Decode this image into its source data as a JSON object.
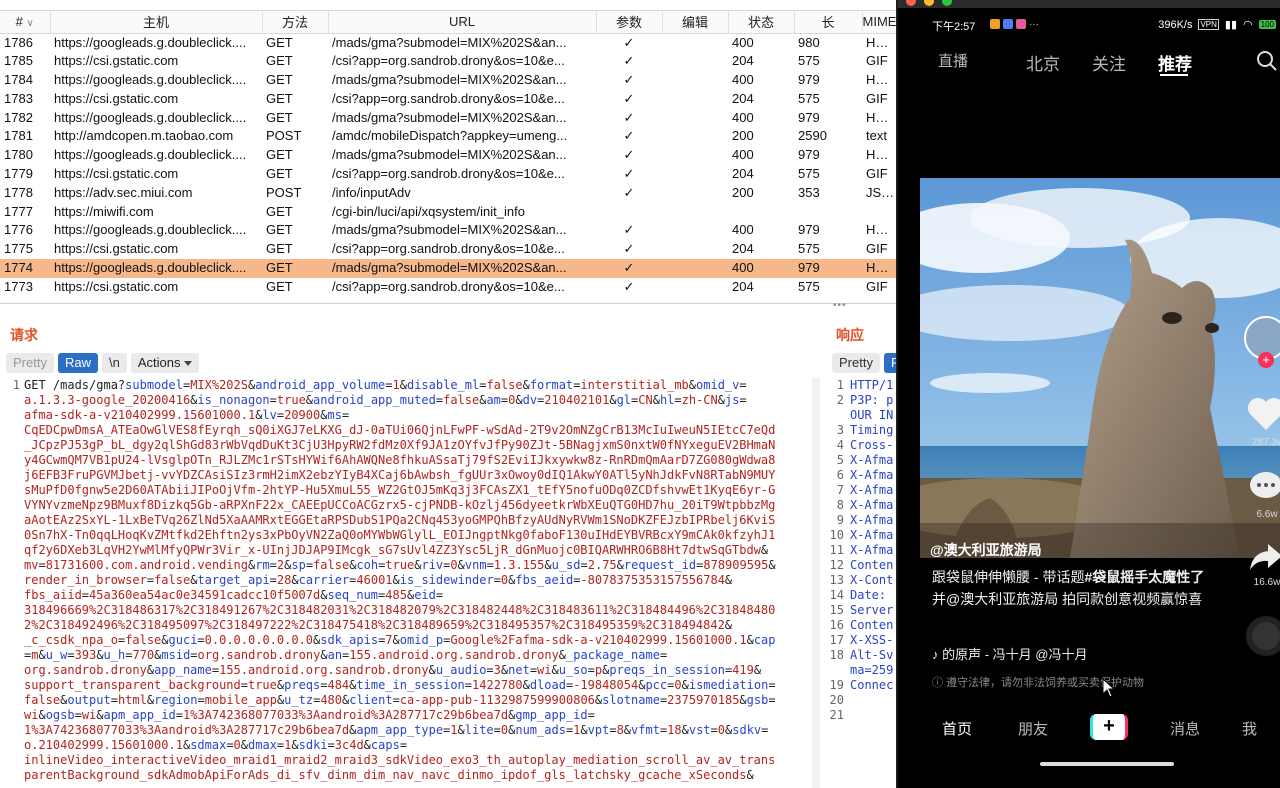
{
  "table": {
    "headers": [
      "#",
      "主机",
      "方法",
      "URL",
      "参数",
      "编辑",
      "状态",
      "长",
      "MIME"
    ],
    "sort_indicator": "∨",
    "rows": [
      {
        "id": "1786",
        "host": "https://googleads.g.doubleclick....",
        "method": "GET",
        "url": "/mads/gma?submodel=MIX%202S&an...",
        "params": "✓",
        "edit": "",
        "status": "400",
        "length": "980",
        "mime": "HTML"
      },
      {
        "id": "1785",
        "host": "https://csi.gstatic.com",
        "method": "GET",
        "url": "/csi?app=org.sandrob.drony&os=10&e...",
        "params": "✓",
        "edit": "",
        "status": "204",
        "length": "575",
        "mime": "GIF"
      },
      {
        "id": "1784",
        "host": "https://googleads.g.doubleclick....",
        "method": "GET",
        "url": "/mads/gma?submodel=MIX%202S&an...",
        "params": "✓",
        "edit": "",
        "status": "400",
        "length": "979",
        "mime": "HTML"
      },
      {
        "id": "1783",
        "host": "https://csi.gstatic.com",
        "method": "GET",
        "url": "/csi?app=org.sandrob.drony&os=10&e...",
        "params": "✓",
        "edit": "",
        "status": "204",
        "length": "575",
        "mime": "GIF"
      },
      {
        "id": "1782",
        "host": "https://googleads.g.doubleclick....",
        "method": "GET",
        "url": "/mads/gma?submodel=MIX%202S&an...",
        "params": "✓",
        "edit": "",
        "status": "400",
        "length": "979",
        "mime": "HTML"
      },
      {
        "id": "1781",
        "host": "http://amdcopen.m.taobao.com",
        "method": "POST",
        "url": "/amdc/mobileDispatch?appkey=umeng...",
        "params": "✓",
        "edit": "",
        "status": "200",
        "length": "2590",
        "mime": "text"
      },
      {
        "id": "1780",
        "host": "https://googleads.g.doubleclick....",
        "method": "GET",
        "url": "/mads/gma?submodel=MIX%202S&an...",
        "params": "✓",
        "edit": "",
        "status": "400",
        "length": "979",
        "mime": "HTML"
      },
      {
        "id": "1779",
        "host": "https://csi.gstatic.com",
        "method": "GET",
        "url": "/csi?app=org.sandrob.drony&os=10&e...",
        "params": "✓",
        "edit": "",
        "status": "204",
        "length": "575",
        "mime": "GIF"
      },
      {
        "id": "1778",
        "host": "https://adv.sec.miui.com",
        "method": "POST",
        "url": "/info/inputAdv",
        "params": "✓",
        "edit": "",
        "status": "200",
        "length": "353",
        "mime": "JSON"
      },
      {
        "id": "1777",
        "host": "https://miwifi.com",
        "method": "GET",
        "url": "/cgi-bin/luci/api/xqsystem/init_info",
        "params": "",
        "edit": "",
        "status": "",
        "length": "",
        "mime": ""
      },
      {
        "id": "1776",
        "host": "https://googleads.g.doubleclick....",
        "method": "GET",
        "url": "/mads/gma?submodel=MIX%202S&an...",
        "params": "✓",
        "edit": "",
        "status": "400",
        "length": "979",
        "mime": "HTML"
      },
      {
        "id": "1775",
        "host": "https://csi.gstatic.com",
        "method": "GET",
        "url": "/csi?app=org.sandrob.drony&os=10&e...",
        "params": "✓",
        "edit": "",
        "status": "204",
        "length": "575",
        "mime": "GIF"
      },
      {
        "id": "1774",
        "host": "https://googleads.g.doubleclick....",
        "method": "GET",
        "url": "/mads/gma?submodel=MIX%202S&an...",
        "params": "✓",
        "edit": "",
        "status": "400",
        "length": "979",
        "mime": "HTML",
        "selected": true
      },
      {
        "id": "1773",
        "host": "https://csi.gstatic.com",
        "method": "GET",
        "url": "/csi?app=org.sandrob.drony&os=10&e...",
        "params": "✓",
        "edit": "",
        "status": "204",
        "length": "575",
        "mime": "GIF"
      }
    ]
  },
  "request_pane": {
    "title": "请求",
    "tabs": {
      "pretty": "Pretty",
      "raw": "Raw",
      "newline": "\\n",
      "actions": "Actions"
    },
    "line_numbers": [
      "1",
      "",
      "",
      "",
      "",
      "",
      "",
      "",
      "",
      "",
      "",
      "",
      "",
      "",
      "",
      "",
      "",
      "",
      "",
      "",
      "",
      "",
      "",
      "",
      "",
      "",
      ""
    ],
    "lines": [
      "GET /mads/gma?submodel=MIX%202S&android_app_volume=1&disable_ml=false&format=interstitial_mb&omid_v=",
      "a.1.3.3-google_20200416&is_nonagon=true&android_app_muted=false&am=0&dv=210402101&gl=CN&hl=zh-CN&js=",
      "afma-sdk-a-v210402999.15601000.1&lv=20900&ms=",
      "CqEDCpwDmsA_ATEaOwGlVES8fEyrqh_sQ0iXGJ7eLKXG_dJ-0aTUi06QjnLFwPF-wSdAd-2T9v2OmNZgCrB13McIuIweuN5IEtcC7eQd",
      "_JCpzPJ53gP_bL_dgy2qlShGd83rWbVqdDuKt3CjU3HpyRW2fdMz0Xf9JA1zOYfvJfPy90ZJt-5BNagjxmS0nxtW0fNYxeguEV2BHmaN",
      "y4GCwmQM7VB1pU24-lVsglpOTn_RJLZMc1rSTsHYWif6AhAWQNe8fhkuASsaTj79fS2EviIJkxywkw8z-RnRDmQmAarD7ZG080gWdwa8",
      "j6EFB3FruPGVMJbetj-vvYDZCAsiSIz3rmH2imX2ebzYIyB4XCaj6bAwbsh_fgUUr3xOwoy0dIQ1AkwY0ATl5yNhJdkFvN8RTabN9MUY",
      "sMuPfD0fgnw5e2D60ATAbiiJIPoOjVfm-2htYP-Hu5XmuL55_WZ2GtOJ5mKq3j3FCAsZX1_tEfY5nofuODq0ZCDfshvwEt1KyqE6yr-G",
      "VYNYvzmeNpz9BMuxf8Dizkq5Gb-aRPXnF22x_CAEEpUCCoACGzrx5-cjPNDB-kOzlj456dyeetkrWbXEuQTG0HD7hu_20iT9WtpbbzMg",
      "aAotEAz2SxYL-1LxBeTVq26ZlNd5XaAAMRxtEGGEtaRPSDubS1PQa2CNq453yoGMPQhBfzyAUdNyRVWm1SNoDKZFEJzbIPRbelj6KviS",
      "0Sn7hX-Tn0qqLHoqKvZMtfkd2Ehftn2ys3xPbOyVN2ZaQ0oMYWbWGlylL_EOIJngptNkg0faboF130uIHdEYBVRBcxY9mCAk0kfzyhJ1",
      "qf2y6DXeb3LqVH2YwMlMfyQPWr3Vir_x-UInjJDJAP9IMcgk_sG7sUvl4ZZ3Ysc5LjR_dGnMuojc0BIQARWHRO6B8Ht7dtwSqGTbdw&",
      "mv=81731600.com.android.vending&rm=2&sp=false&coh=true&riv=0&vnm=1.3.155&u_sd=2.75&request_id=878909595&",
      "render_in_browser=false&target_api=28&carrier=46001&is_sidewinder=0&fbs_aeid=-8078375353157556784&",
      "fbs_aiid=45a360ea54ac0e34591cadcc10f5007d&seq_num=485&eid=",
      "318496669%2C318486317%2C318491267%2C318482031%2C318482079%2C318482448%2C318483611%2C318484496%2C31848480",
      "2%2C318492496%2C318495097%2C318497222%2C318475418%2C318489659%2C318495357%2C318495359%2C318494842&",
      "_c_csdk_npa_o=false&guci=0.0.0.0.0.0.0.0&sdk_apis=7&omid_p=Google%2Fafma-sdk-a-v210402999.15601000.1&cap",
      "=m&u_w=393&u_h=770&msid=org.sandrob.drony&an=155.android.org.sandrob.drony&_package_name=",
      "org.sandrob.drony&app_name=155.android.org.sandrob.drony&u_audio=3&net=wi&u_so=p&preqs_in_session=419&",
      "support_transparent_background=true&preqs=484&time_in_session=1422780&dload=-19848054&pcc=0&ismediation=",
      "false&output=html&region=mobile_app&u_tz=480&client=ca-app-pub-1132987599900806&slotname=2375970185&gsb=",
      "wi&ogsb=wi&apm_app_id=1%3A742368077033%3Aandroid%3A287717c29b6bea7d&gmp_app_id=",
      "1%3A742368077033%3Aandroid%3A287717c29b6bea7d&apm_app_type=1&lite=0&num_ads=1&vpt=8&vfmt=18&vst=0&sdkv=",
      "o.210402999.15601000.1&sdmax=0&dmax=1&sdki=3c4d&caps=",
      "inlineVideo_interactiveVideo_mraid1_mraid2_mraid3_sdkVideo_exo3_th_autoplay_mediation_scroll_av_av_trans",
      "parentBackground_sdkAdmobApiForAds_di_sfv_dinm_dim_nav_navc_dinmo_ipdof_gls_latchsky_gcache_xSeconds&"
    ]
  },
  "response_pane": {
    "title": "响应",
    "tab_pretty": "Pretty",
    "tab_raw_partial": "R",
    "lines": [
      {
        "n": "1",
        "text": "HTTP/1"
      },
      {
        "n": "2",
        "text": "P3P: p"
      },
      {
        "n": "",
        "text": "OUR IN"
      },
      {
        "n": "3",
        "text": "Timing"
      },
      {
        "n": "4",
        "text": "Cross-"
      },
      {
        "n": "5",
        "text": "X-Afma"
      },
      {
        "n": "6",
        "text": "X-Afma"
      },
      {
        "n": "7",
        "text": "X-Afma"
      },
      {
        "n": "8",
        "text": "X-Afma"
      },
      {
        "n": "9",
        "text": "X-Afma"
      },
      {
        "n": "10",
        "text": "X-Afma"
      },
      {
        "n": "11",
        "text": "X-Afma"
      },
      {
        "n": "12",
        "text": "Conten"
      },
      {
        "n": "13",
        "text": "X-Cont"
      },
      {
        "n": "14",
        "text": "Date: "
      },
      {
        "n": "15",
        "text": "Server"
      },
      {
        "n": "16",
        "text": "Conten"
      },
      {
        "n": "17",
        "text": "X-XSS-"
      },
      {
        "n": "18",
        "text": "Alt-Sv"
      },
      {
        "n": "",
        "text": "ma=259"
      },
      {
        "n": "19",
        "text": "Connec"
      },
      {
        "n": "20",
        "text": ""
      },
      {
        "n": "21",
        "text": ""
      }
    ]
  },
  "phone": {
    "window_title": "MIX 2S",
    "status_time": "下午2:57",
    "status_speed": "396K/s",
    "status_network": "VPN",
    "status_battery": "100",
    "top_nav": {
      "live": "直播",
      "city": "北京",
      "follow": "关注",
      "recommend": "推荐"
    },
    "author": "@澳大利亚旅游局",
    "caption_plain": "跟袋鼠伸伸懒腰 - 带话题",
    "caption_tag": "#袋鼠摇手太魔性了",
    "caption_rest": "并@澳大利亚旅游局 拍同款创意视频赢惊喜",
    "music": "♪ 的原声 - 冯十月    @冯十月",
    "notice": "ⓘ 遵守法律，请勿非法饲养或买卖保护动物",
    "likes": "287.3w",
    "comments": "6.6w",
    "shares": "16.6w",
    "bottom_nav": {
      "home": "首页",
      "friends": "朋友",
      "plus": "+",
      "messages": "消息",
      "me": "我"
    }
  },
  "colors": {
    "selected_row": "#f6b78a",
    "raw_tab": "#2c6fc4",
    "pane_title": "#e0532a",
    "param_key": "#2a44c8",
    "param_value": "#b3241f"
  }
}
